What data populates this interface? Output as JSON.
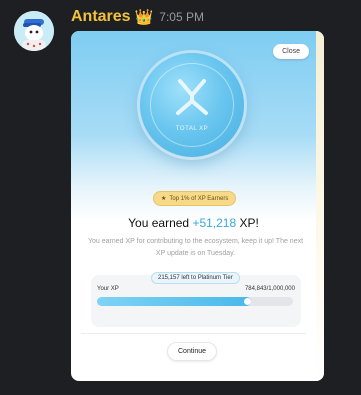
{
  "message": {
    "username": "Antares",
    "crown_icon": "👑",
    "timestamp": "7:05 PM"
  },
  "modal": {
    "close_label": "Close",
    "coin_label": "TOTAL XP",
    "badge_label": "Top 1% of XP Earners",
    "earned_prefix": "You earned",
    "earned_value": "+51,218",
    "earned_suffix": "XP!",
    "description": "You earned XP for contributing to the ecosystem, keep it up! The next XP update is on Tuesday.",
    "tier_text": "215,157 left to Platinum Tier",
    "your_xp_label": "Your XP",
    "xp_progress_text": "784,843/1,000,000",
    "xp_progress_fraction": 0.785,
    "continue_label": "Continue"
  },
  "colors": {
    "username": "#f0c43a",
    "accent_blue": "#35a8e0",
    "badge_gold": "#f7d98a"
  }
}
